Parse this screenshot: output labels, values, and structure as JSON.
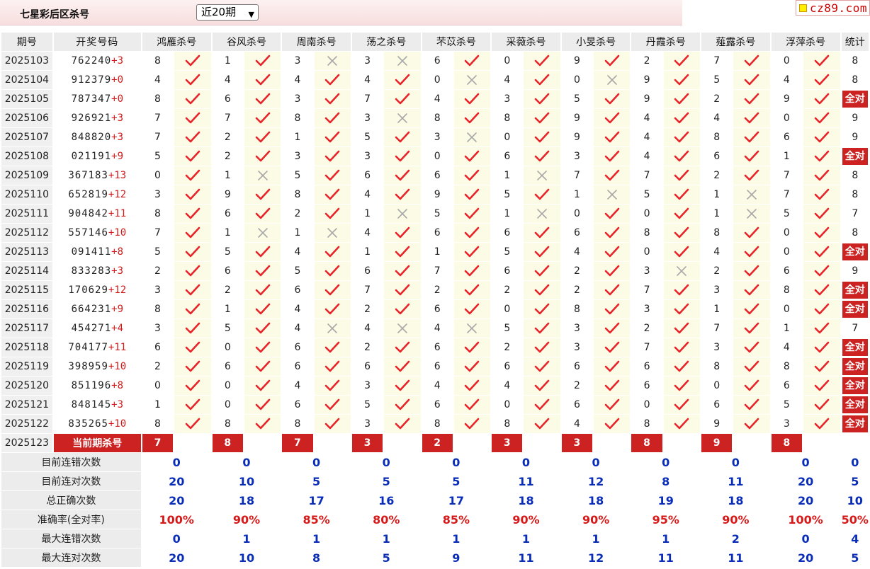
{
  "header": {
    "title": "七星彩后区杀号",
    "period_select": "近20期",
    "logo_text": "cz89.com"
  },
  "columns": {
    "issue": "期号",
    "draw": "开奖号码",
    "experts": [
      "鸿雁杀号",
      "谷风杀号",
      "周南杀号",
      "荡之杀号",
      "芣苡杀号",
      "采薇杀号",
      "小旻杀号",
      "丹霞杀号",
      "薤露杀号",
      "浮萍杀号"
    ],
    "stats": "统计"
  },
  "all_correct_label": "全对",
  "rows": [
    {
      "issue": "2025103",
      "main": "762240",
      "plus": "+3",
      "kills": [
        8,
        1,
        3,
        3,
        6,
        0,
        9,
        2,
        7,
        0
      ],
      "hits": [
        1,
        1,
        0,
        0,
        1,
        1,
        1,
        1,
        1,
        1
      ],
      "stat": "8"
    },
    {
      "issue": "2025104",
      "main": "912379",
      "plus": "+0",
      "kills": [
        4,
        4,
        4,
        4,
        0,
        4,
        0,
        9,
        5,
        4
      ],
      "hits": [
        1,
        1,
        1,
        1,
        0,
        1,
        0,
        1,
        1,
        1
      ],
      "stat": "8"
    },
    {
      "issue": "2025105",
      "main": "787347",
      "plus": "+0",
      "kills": [
        8,
        6,
        3,
        7,
        4,
        3,
        5,
        9,
        2,
        9
      ],
      "hits": [
        1,
        1,
        1,
        1,
        1,
        1,
        1,
        1,
        1,
        1
      ],
      "stat": "全对"
    },
    {
      "issue": "2025106",
      "main": "926921",
      "plus": "+3",
      "kills": [
        7,
        7,
        8,
        3,
        8,
        8,
        9,
        4,
        4,
        0
      ],
      "hits": [
        1,
        1,
        1,
        0,
        1,
        1,
        1,
        1,
        1,
        1
      ],
      "stat": "9"
    },
    {
      "issue": "2025107",
      "main": "848820",
      "plus": "+3",
      "kills": [
        7,
        2,
        1,
        5,
        3,
        0,
        9,
        4,
        8,
        6
      ],
      "hits": [
        1,
        1,
        1,
        1,
        0,
        1,
        1,
        1,
        1,
        1
      ],
      "stat": "9"
    },
    {
      "issue": "2025108",
      "main": "021191",
      "plus": "+9",
      "kills": [
        5,
        2,
        3,
        3,
        0,
        6,
        3,
        4,
        6,
        1
      ],
      "hits": [
        1,
        1,
        1,
        1,
        1,
        1,
        1,
        1,
        1,
        1
      ],
      "stat": "全对"
    },
    {
      "issue": "2025109",
      "main": "367183",
      "plus": "+13",
      "kills": [
        0,
        1,
        5,
        6,
        6,
        1,
        7,
        7,
        2,
        7
      ],
      "hits": [
        1,
        0,
        1,
        1,
        1,
        0,
        1,
        1,
        1,
        1
      ],
      "stat": "8"
    },
    {
      "issue": "2025110",
      "main": "652819",
      "plus": "+12",
      "kills": [
        3,
        9,
        8,
        4,
        9,
        5,
        1,
        5,
        1,
        7
      ],
      "hits": [
        1,
        1,
        1,
        1,
        1,
        1,
        0,
        1,
        0,
        1
      ],
      "stat": "8"
    },
    {
      "issue": "2025111",
      "main": "904842",
      "plus": "+11",
      "kills": [
        8,
        6,
        2,
        1,
        5,
        1,
        0,
        0,
        1,
        5
      ],
      "hits": [
        1,
        1,
        1,
        0,
        1,
        0,
        1,
        1,
        0,
        1
      ],
      "stat": "7"
    },
    {
      "issue": "2025112",
      "main": "557146",
      "plus": "+10",
      "kills": [
        7,
        1,
        1,
        4,
        6,
        6,
        6,
        8,
        8,
        0
      ],
      "hits": [
        1,
        0,
        0,
        1,
        1,
        1,
        1,
        1,
        1,
        1
      ],
      "stat": "8"
    },
    {
      "issue": "2025113",
      "main": "091411",
      "plus": "+8",
      "kills": [
        5,
        5,
        4,
        1,
        1,
        5,
        4,
        0,
        4,
        0
      ],
      "hits": [
        1,
        1,
        1,
        1,
        1,
        1,
        1,
        1,
        1,
        1
      ],
      "stat": "全对"
    },
    {
      "issue": "2025114",
      "main": "833283",
      "plus": "+3",
      "kills": [
        2,
        6,
        5,
        6,
        7,
        6,
        2,
        3,
        2,
        6
      ],
      "hits": [
        1,
        1,
        1,
        1,
        1,
        1,
        1,
        0,
        1,
        1
      ],
      "stat": "9"
    },
    {
      "issue": "2025115",
      "main": "170629",
      "plus": "+12",
      "kills": [
        3,
        2,
        6,
        7,
        2,
        2,
        2,
        7,
        3,
        8
      ],
      "hits": [
        1,
        1,
        1,
        1,
        1,
        1,
        1,
        1,
        1,
        1
      ],
      "stat": "全对"
    },
    {
      "issue": "2025116",
      "main": "664231",
      "plus": "+9",
      "kills": [
        8,
        1,
        4,
        2,
        6,
        0,
        8,
        3,
        1,
        0
      ],
      "hits": [
        1,
        1,
        1,
        1,
        1,
        1,
        1,
        1,
        1,
        1
      ],
      "stat": "全对"
    },
    {
      "issue": "2025117",
      "main": "454271",
      "plus": "+4",
      "kills": [
        3,
        5,
        4,
        4,
        4,
        5,
        3,
        2,
        7,
        1
      ],
      "hits": [
        1,
        1,
        0,
        0,
        0,
        1,
        1,
        1,
        1,
        1
      ],
      "stat": "7"
    },
    {
      "issue": "2025118",
      "main": "704177",
      "plus": "+11",
      "kills": [
        6,
        0,
        6,
        2,
        6,
        2,
        3,
        7,
        3,
        4
      ],
      "hits": [
        1,
        1,
        1,
        1,
        1,
        1,
        1,
        1,
        1,
        1
      ],
      "stat": "全对"
    },
    {
      "issue": "2025119",
      "main": "398959",
      "plus": "+10",
      "kills": [
        2,
        6,
        6,
        6,
        6,
        6,
        6,
        6,
        8,
        8
      ],
      "hits": [
        1,
        1,
        1,
        1,
        1,
        1,
        1,
        1,
        1,
        1
      ],
      "stat": "全对"
    },
    {
      "issue": "2025120",
      "main": "851196",
      "plus": "+8",
      "kills": [
        0,
        0,
        4,
        3,
        4,
        4,
        2,
        6,
        0,
        6
      ],
      "hits": [
        1,
        1,
        1,
        1,
        1,
        1,
        1,
        1,
        1,
        1
      ],
      "stat": "全对"
    },
    {
      "issue": "2025121",
      "main": "848145",
      "plus": "+3",
      "kills": [
        1,
        0,
        6,
        5,
        6,
        0,
        6,
        0,
        6,
        5
      ],
      "hits": [
        1,
        1,
        1,
        1,
        1,
        1,
        1,
        1,
        1,
        1
      ],
      "stat": "全对"
    },
    {
      "issue": "2025122",
      "main": "835265",
      "plus": "+10",
      "kills": [
        8,
        8,
        8,
        3,
        8,
        8,
        4,
        8,
        9,
        3
      ],
      "hits": [
        1,
        1,
        1,
        1,
        1,
        1,
        1,
        1,
        1,
        1
      ],
      "stat": "全对"
    }
  ],
  "current": {
    "issue": "2025123",
    "label": "当前期杀号",
    "kills": [
      7,
      8,
      7,
      3,
      2,
      3,
      3,
      8,
      9,
      8
    ]
  },
  "summary": [
    {
      "label": "目前连错次数",
      "values": [
        "0",
        "0",
        "0",
        "0",
        "0",
        "0",
        "0",
        "0",
        "0",
        "0"
      ],
      "total": "0",
      "rate": false
    },
    {
      "label": "目前连对次数",
      "values": [
        "20",
        "10",
        "5",
        "5",
        "5",
        "11",
        "12",
        "8",
        "11",
        "20"
      ],
      "total": "5",
      "rate": false
    },
    {
      "label": "总正确次数",
      "values": [
        "20",
        "18",
        "17",
        "16",
        "17",
        "18",
        "18",
        "19",
        "18",
        "20"
      ],
      "total": "10",
      "rate": false
    },
    {
      "label": "准确率(全对率)",
      "values": [
        "100%",
        "90%",
        "85%",
        "80%",
        "85%",
        "90%",
        "90%",
        "95%",
        "90%",
        "100%"
      ],
      "total": "50%",
      "rate": true
    },
    {
      "label": "最大连错次数",
      "values": [
        "0",
        "1",
        "1",
        "1",
        "1",
        "1",
        "1",
        "1",
        "2",
        "0"
      ],
      "total": "4",
      "rate": false
    },
    {
      "label": "最大连对次数",
      "values": [
        "20",
        "10",
        "8",
        "5",
        "9",
        "11",
        "12",
        "11",
        "11",
        "20"
      ],
      "total": "5",
      "rate": false
    }
  ],
  "colors": {
    "accent_red": "#cc2222",
    "check_red": "#e8232a",
    "cross_gray": "#a8a8a8",
    "stat_blue": "#0a2db8"
  }
}
